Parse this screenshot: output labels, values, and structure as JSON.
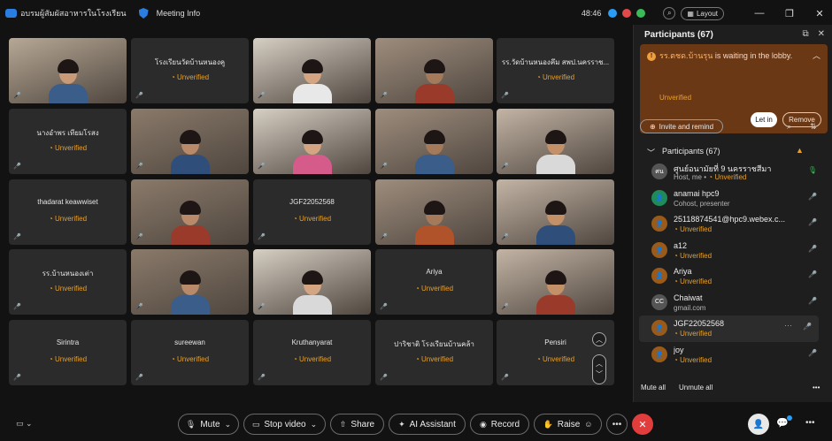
{
  "window": {
    "app_title": "อบรมผู้สัมผัสอาหารในโรงเรียน",
    "meeting_info": "Meeting Info",
    "timer": "48:46",
    "layout_label": "Layout"
  },
  "grid": {
    "unverified_label": "Unverified",
    "tiles": [
      {
        "name": "",
        "video": true
      },
      {
        "name": "โรงเรียนวัดบ้านหนองคู",
        "video": false
      },
      {
        "name": "",
        "video": true
      },
      {
        "name": "",
        "video": true
      },
      {
        "name": "รร.วัดบ้านหนองคึม สพป.นครราช...",
        "video": false
      },
      {
        "name": "นางอำพร เทียมโรสง",
        "video": false
      },
      {
        "name": "",
        "video": true
      },
      {
        "name": "",
        "video": true
      },
      {
        "name": "",
        "video": true
      },
      {
        "name": "",
        "video": true
      },
      {
        "name": "thadarat keawwiset",
        "video": false
      },
      {
        "name": "",
        "video": true
      },
      {
        "name": "JGF22052568",
        "video": false
      },
      {
        "name": "",
        "video": true
      },
      {
        "name": "",
        "video": true
      },
      {
        "name": "รร.บ้านหนองเต่า",
        "video": false
      },
      {
        "name": "",
        "video": true
      },
      {
        "name": "",
        "video": true
      },
      {
        "name": "Ariya",
        "video": false
      },
      {
        "name": "",
        "video": true
      },
      {
        "name": "Sirintra",
        "video": false
      },
      {
        "name": "sureewan",
        "video": false
      },
      {
        "name": "Kruthanyarat",
        "video": false
      },
      {
        "name": "ปาริชาติ โรงเรียนบ้านคล้า",
        "video": false
      },
      {
        "name": "Pensiri",
        "video": false
      }
    ]
  },
  "panel": {
    "title": "Participants (67)",
    "lobby": {
      "name": "รร.ตชด.บ้านรุน",
      "message": " is waiting in the lobby.",
      "status": "Unverified",
      "let_in": "Let in",
      "remove": "Remove"
    },
    "invite_label": "Invite and remind",
    "section_label": "Participants (67)",
    "participants": [
      {
        "initials": "ศน",
        "name": "ศูนย์อนามัยที่ 9 นครราชสีมา",
        "sub": "Host, me • ",
        "sub2": "Unverified",
        "color": "#555",
        "mic": "green"
      },
      {
        "initials": "",
        "name": "anamai hpc9",
        "sub": "Cohost, presenter",
        "sub2": "",
        "color": "#1f8a5a",
        "mic": "red"
      },
      {
        "initials": "",
        "name": "25118874541@hpc9.webex.c...",
        "sub": "",
        "sub2": "Unverified",
        "color": "#9a5a1a",
        "mic": "red"
      },
      {
        "initials": "",
        "name": "a12",
        "sub": "",
        "sub2": "Unverified",
        "color": "#9a5a1a",
        "mic": "red"
      },
      {
        "initials": "",
        "name": "Ariya",
        "sub": "",
        "sub2": "Unverified",
        "color": "#9a5a1a",
        "mic": "red"
      },
      {
        "initials": "CC",
        "name": "Chaiwat",
        "sub": "gmail.com",
        "sub2": "",
        "color": "#555",
        "mic": "red"
      },
      {
        "initials": "",
        "name": "JGF22052568",
        "sub": "",
        "sub2": "Unverified",
        "color": "#9a5a1a",
        "mic": "red",
        "highlight": true
      },
      {
        "initials": "",
        "name": "joy",
        "sub": "",
        "sub2": "Unverified",
        "color": "#9a5a1a",
        "mic": "red"
      }
    ],
    "mute_all": "Mute all",
    "unmute_all": "Unmute all"
  },
  "toolbar": {
    "mute": "Mute",
    "stop_video": "Stop video",
    "share": "Share",
    "ai_assistant": "AI Assistant",
    "record": "Record",
    "raise": "Raise"
  }
}
